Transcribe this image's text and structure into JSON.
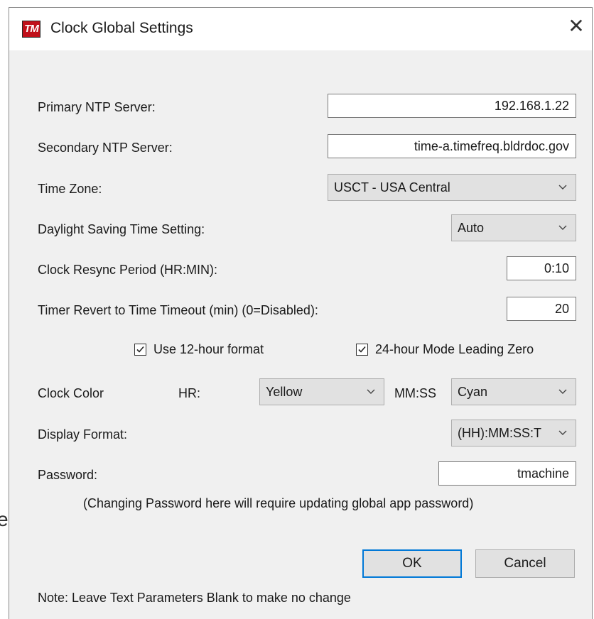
{
  "background": {
    "fragment": "e"
  },
  "window": {
    "title": "Clock Global Settings",
    "icon_text": "TM",
    "icon_color": "#c0101a",
    "close_glyph": "✕"
  },
  "fields": {
    "primary_ntp": {
      "label": "Primary NTP Server:",
      "value": "192.168.1.22"
    },
    "secondary_ntp": {
      "label": "Secondary NTP Server:",
      "value": "time-a.timefreq.bldrdoc.gov"
    },
    "time_zone": {
      "label": "Time Zone:",
      "value": "USCT - USA Central"
    },
    "dst": {
      "label": "Daylight Saving Time Setting:",
      "value": "Auto"
    },
    "resync": {
      "label": "Clock Resync Period (HR:MIN):",
      "value": "0:10"
    },
    "timer_revert": {
      "label": "Timer Revert to Time Timeout (min) (0=Disabled):",
      "value": "20"
    }
  },
  "checkboxes": {
    "use_12_hour": {
      "label": "Use 12-hour format",
      "checked": true
    },
    "leading_zero": {
      "label": "24-hour Mode Leading Zero",
      "checked": true
    }
  },
  "clock_color": {
    "label": "Clock Color",
    "hr_label": "HR:",
    "hr_value": "Yellow",
    "mmss_label": "MM:SS",
    "mmss_value": "Cyan"
  },
  "display_format": {
    "label": "Display Format:",
    "value": "(HH):MM:SS:T"
  },
  "password": {
    "label": "Password:",
    "value": "tmachine",
    "note": "(Changing Password here will require updating global app password)"
  },
  "buttons": {
    "ok": "OK",
    "cancel": "Cancel"
  },
  "footer_note": "Note: Leave Text Parameters Blank to make no change",
  "colors": {
    "accent": "#0078d7",
    "dialog_bg": "#f0f0f0"
  }
}
